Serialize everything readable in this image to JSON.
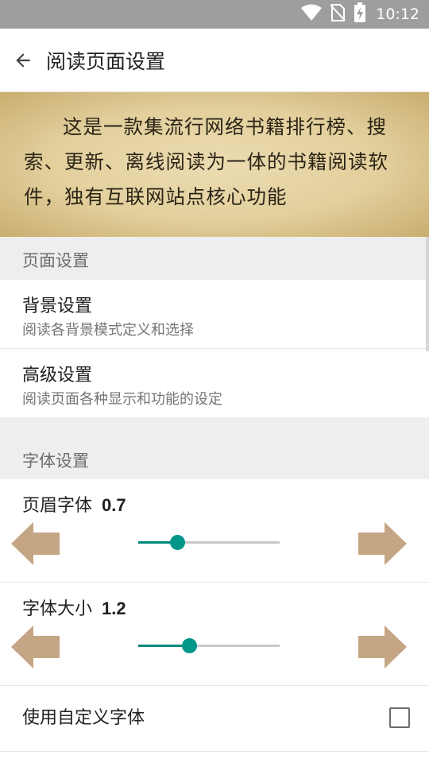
{
  "status_bar": {
    "time": "10:12",
    "icons": [
      "wifi-icon",
      "no-sim-icon",
      "battery-charging-icon"
    ]
  },
  "app_bar": {
    "back_icon": "arrow-back-icon",
    "title": "阅读页面设置"
  },
  "preview": {
    "text": "这是一款集流行网络书籍排行榜、搜索、更新、离线阅读为一体的书籍阅读软件，独有互联网站点核心功能"
  },
  "page_settings": {
    "header": "页面设置",
    "items": [
      {
        "title": "背景设置",
        "summary": "阅读各背景模式定义和选择"
      },
      {
        "title": "高级设置",
        "summary": "阅读页面各种显示和功能的设定"
      }
    ]
  },
  "font_settings": {
    "header": "字体设置",
    "sliders": [
      {
        "label": "页眉字体",
        "value_text": "0.7",
        "fraction": 0.28
      },
      {
        "label": "字体大小",
        "value_text": "1.2",
        "fraction": 0.36
      }
    ],
    "custom_font": {
      "label": "使用自定义字体",
      "checked": false
    }
  },
  "colors": {
    "accent": "#008a7c",
    "arrow": "#c4a584",
    "status_bar": "#9e9e9e",
    "section_bg": "#eeeeee"
  }
}
